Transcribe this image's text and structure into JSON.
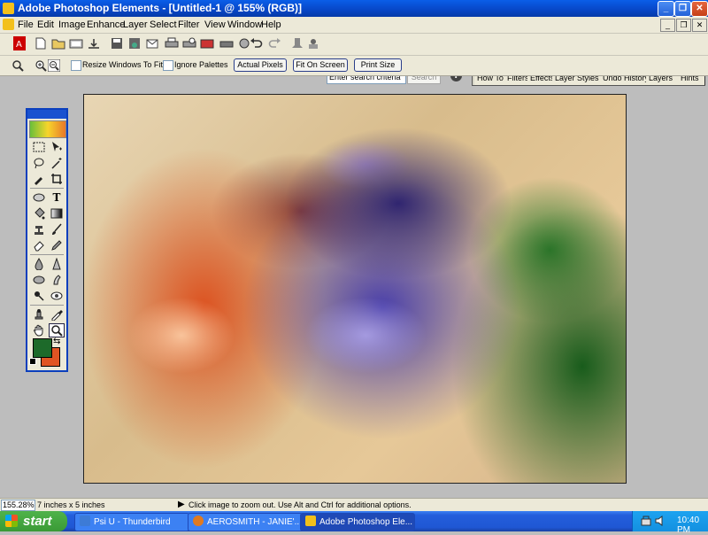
{
  "window": {
    "title": "Adobe Photoshop Elements - [Untitled-1 @ 155% (RGB)]",
    "controls": [
      "_",
      "❐",
      "✕"
    ]
  },
  "menu": {
    "items": [
      "File",
      "Edit",
      "Image",
      "Enhance",
      "Layer",
      "Select",
      "Filter",
      "View",
      "Window",
      "Help"
    ],
    "doc_controls": [
      "_",
      "❐",
      "✕"
    ]
  },
  "shortcuts": {
    "search_placeholder": "Enter search criteria",
    "search_button": "Search",
    "help": "?"
  },
  "palette_well": {
    "tabs": [
      "How To",
      "Filters",
      "Effects",
      "Layer Styles",
      "Undo History",
      "Layers",
      "Hints"
    ]
  },
  "options_bar": {
    "resize_windows_label": "Resize Windows To Fit",
    "ignore_palettes_label": "Ignore Palettes",
    "actual_pixels": "Actual Pixels",
    "fit_on_screen": "Fit On Screen",
    "print_size": "Print Size"
  },
  "colors": {
    "foreground": "#1d6a2a",
    "background": "#e05423",
    "title_bar": "#0a5ee8"
  },
  "status": {
    "zoom": "155.28%",
    "doc_size": "7 inches x 5 inches",
    "hint": "Click image to zoom out. Use Alt and Ctrl for additional options."
  },
  "taskbar": {
    "start": "start",
    "tasks": [
      "Psi U - Thunderbird",
      "AEROSMITH - JANIE'...",
      "Adobe Photoshop Ele..."
    ],
    "clock": "10:40 PM"
  }
}
